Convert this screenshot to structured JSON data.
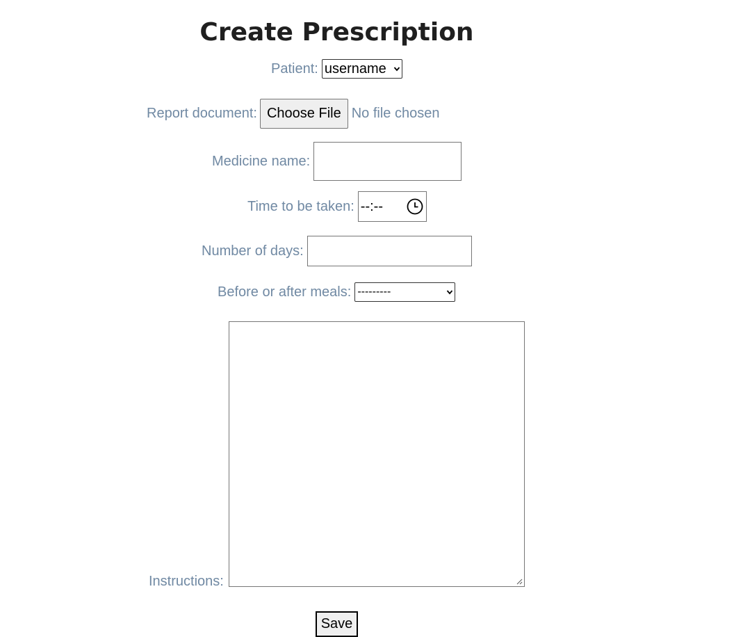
{
  "title": "Create Prescription",
  "form": {
    "patient": {
      "label": "Patient:",
      "selected": "username"
    },
    "report_document": {
      "label": "Report document:",
      "button_label": "Choose File",
      "status_text": "No file chosen"
    },
    "medicine_name": {
      "label": "Medicine name:",
      "value": ""
    },
    "time_to_be_taken": {
      "label": "Time to be taken:",
      "value": "--:--"
    },
    "number_of_days": {
      "label": "Number of days:",
      "value": ""
    },
    "meals": {
      "label": "Before or after meals:",
      "selected": "---------"
    },
    "instructions": {
      "label": "Instructions:",
      "value": ""
    },
    "save_label": "Save"
  },
  "icons": {
    "clock": "clock-icon",
    "chevron": "chevron-down-icon",
    "resize": "resize-grip-icon"
  }
}
